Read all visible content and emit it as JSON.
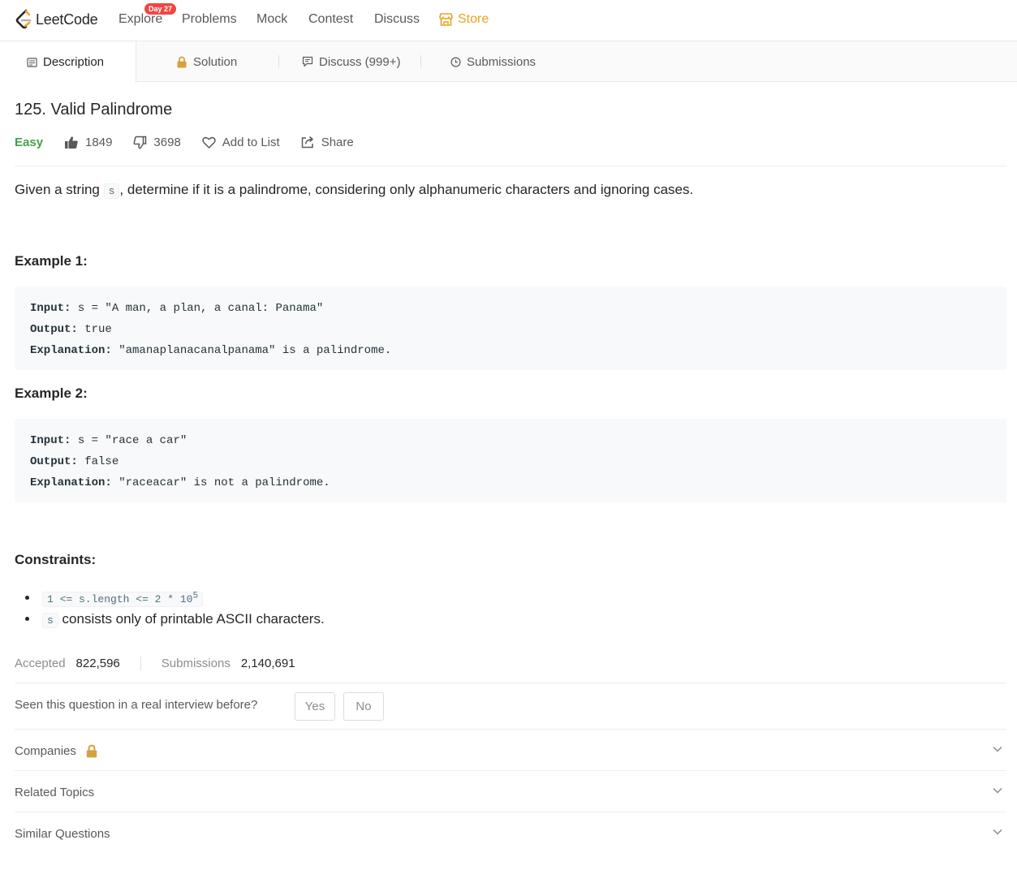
{
  "nav": {
    "logo_text": "LeetCode",
    "items": [
      "Explore",
      "Problems",
      "Mock",
      "Contest",
      "Discuss"
    ],
    "store": "Store",
    "badge": "Day 27",
    "brand_color": "#ffa116"
  },
  "tabs": [
    {
      "label": "Description",
      "icon": "description-icon"
    },
    {
      "label": "Solution",
      "icon": "lock-icon"
    },
    {
      "label": "Discuss (999+)",
      "icon": "discuss-icon"
    },
    {
      "label": "Submissions",
      "icon": "clock-icon"
    }
  ],
  "problem": {
    "title": "125. Valid Palindrome",
    "difficulty": "Easy",
    "likes": "1849",
    "dislikes": "3698",
    "add_to_list": "Add to List",
    "share": "Share",
    "description_pre": "Given a string ",
    "description_code": "s",
    "description_post": ", determine if it is a palindrome, considering only alphanumeric characters and ignoring cases."
  },
  "examples": [
    {
      "heading": "Example 1:",
      "input_label": "Input:",
      "input": " s = \"A man, a plan, a canal: Panama\"",
      "output_label": "Output:",
      "output": " true",
      "explanation_label": "Explanation:",
      "explanation": " \"amanaplanacanalpanama\" is a palindrome."
    },
    {
      "heading": "Example 2:",
      "input_label": "Input:",
      "input": " s = \"race a car\"",
      "output_label": "Output:",
      "output": " false",
      "explanation_label": "Explanation:",
      "explanation": " \"raceacar\" is not a palindrome."
    }
  ],
  "constraints": {
    "heading": "Constraints:",
    "c1_code": "1 <= s.length <= 2 * 10",
    "c1_sup": "5",
    "c2_code": "s",
    "c2_text": " consists only of printable ASCII characters."
  },
  "stats": {
    "accepted_label": "Accepted",
    "accepted": "822,596",
    "submissions_label": "Submissions",
    "submissions": "2,140,691"
  },
  "interview": {
    "question": "Seen this question in a real interview before?",
    "yes": "Yes",
    "no": "No"
  },
  "sections": [
    "Companies",
    "Related Topics",
    "Similar Questions"
  ],
  "colors": {
    "easy": "#43a047",
    "store": "#f0a020",
    "badge": "#ef4743",
    "lock": "#d9a040"
  }
}
